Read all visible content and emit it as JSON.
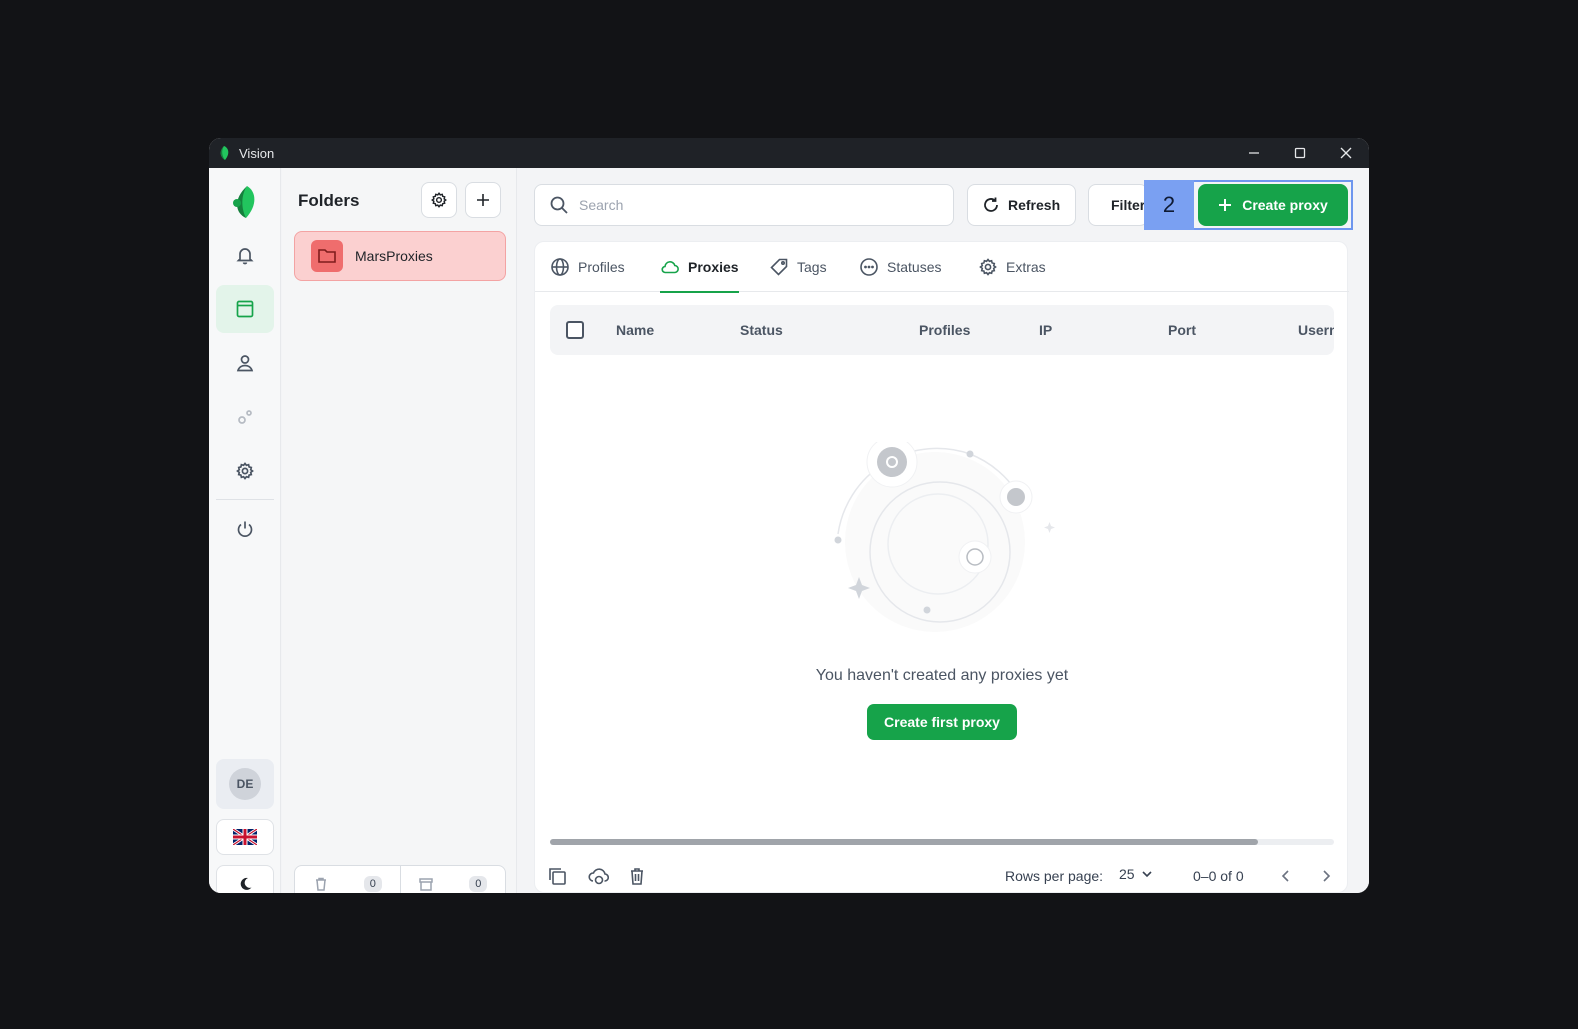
{
  "window": {
    "title": "Vision"
  },
  "rail": {
    "items": [
      "logo-icon",
      "bell-icon",
      "browser-icon",
      "user-icon",
      "gears-icon",
      "settings-icon",
      "power-icon"
    ],
    "user_initials": "DE",
    "language_flag": "uk-flag-icon",
    "theme_icon": "moon-icon"
  },
  "folders": {
    "title": "Folders",
    "items": [
      {
        "label": "MarsProxies",
        "color": "#ef6d6d"
      }
    ],
    "footer": {
      "trash_count": "0",
      "archive_count": "0"
    }
  },
  "toolbar": {
    "search_placeholder": "Search",
    "refresh_label": "Refresh",
    "filter_label": "Filters",
    "create_label": "Create proxy",
    "step_badge": "2"
  },
  "tabs": [
    {
      "label": "Profiles",
      "icon": "globe-icon"
    },
    {
      "label": "Proxies",
      "icon": "cloud-icon",
      "active": true
    },
    {
      "label": "Tags",
      "icon": "tag-icon"
    },
    {
      "label": "Statuses",
      "icon": "dots-circle-icon"
    },
    {
      "label": "Extras",
      "icon": "gear-icon"
    }
  ],
  "table": {
    "columns": [
      "Name",
      "Status",
      "Profiles",
      "IP",
      "Port",
      "Username"
    ],
    "rows": []
  },
  "empty_state": {
    "message": "You haven't created any proxies yet",
    "button_label": "Create first proxy"
  },
  "pagination": {
    "rows_per_page_label": "Rows per page:",
    "rows_per_page_value": "25",
    "range": "0–0 of 0"
  },
  "colors": {
    "accent": "#16a34a",
    "folder": "#ef6d6d",
    "highlight": "#7aa0f2"
  }
}
